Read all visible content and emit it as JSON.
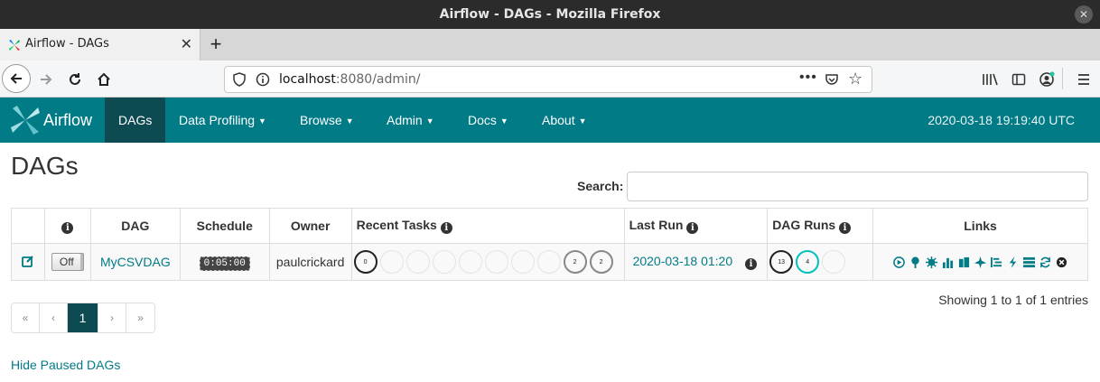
{
  "window": {
    "title": "Airflow - DAGs - Mozilla Firefox"
  },
  "browser": {
    "tab_title": "Airflow - DAGs",
    "url_host": "localhost",
    "url_rest": ":8080/admin/"
  },
  "airflow": {
    "brand": "Airflow",
    "menu": [
      "DAGs",
      "Data Profiling",
      "Browse",
      "Admin",
      "Docs",
      "About"
    ],
    "server_time": "2020-03-18 19:19:40 UTC",
    "page_title": "DAGs",
    "search_label": "Search:",
    "search_value": "",
    "columns": [
      "DAG",
      "Schedule",
      "Owner",
      "Recent Tasks",
      "Last Run",
      "DAG Runs",
      "Links"
    ],
    "row": {
      "toggle": "Off",
      "dag_id": "MyCSVDAG",
      "schedule": "0:05:00",
      "owner": "paulcrickard",
      "recent_tasks": [
        "0",
        "",
        "",
        "",
        "",
        "",
        "",
        "",
        "2",
        "2"
      ],
      "last_run": "2020-03-18 01:20",
      "dag_runs": [
        "13",
        "4",
        ""
      ]
    },
    "showing": "Showing 1 to 1 of 1 entries",
    "pager": [
      "«",
      "‹",
      "1",
      "›",
      "»"
    ],
    "hide_paused": "Hide Paused DAGs"
  },
  "colors": {
    "primary": "#017b86",
    "nav_active": "#0d4a52",
    "success": "#008000",
    "running": "#00bfbf"
  }
}
